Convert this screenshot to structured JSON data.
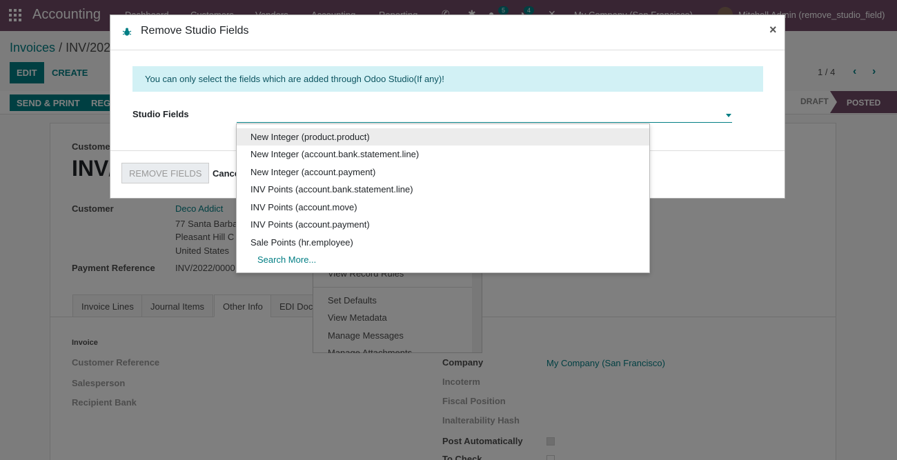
{
  "navbar": {
    "app_name": "Accounting",
    "menus": [
      "Dashboard",
      "Customers",
      "Vendors",
      "Accounting",
      "Reporting"
    ],
    "chat_count": "5",
    "activity_count": "4",
    "company": "My Company (San Francisco)",
    "user": "Mitchell Admin (remove_studio_field)"
  },
  "breadcrumb": {
    "parent": "Invoices",
    "current": "INV/2022"
  },
  "control": {
    "edit_label": "EDIT",
    "create_label": "CREATE",
    "pager": "1 / 4",
    "prev_icon": "‹",
    "next_icon": "›"
  },
  "statusbar": {
    "send_print_label": "SEND & PRINT",
    "register_label": "REGI",
    "stage_draft": "DRAFT",
    "stage_posted": "POSTED"
  },
  "sheet": {
    "type_label": "Customer",
    "title": "INV/",
    "customer_label": "Customer",
    "customer_name": "Deco Addict",
    "address_line1": "77 Santa Barba",
    "address_line2": "Pleasant Hill C",
    "address_line3": "United States",
    "payment_ref_label": "Payment Reference",
    "payment_ref_value": "INV/2022/0000",
    "tabs": [
      "Invoice Lines",
      "Journal Items",
      "Other Info",
      "EDI Docu"
    ],
    "section_invoice": "Invoice",
    "customer_reference_label": "Customer Reference",
    "salesperson_label": "Salesperson",
    "recipient_bank_label": "Recipient Bank",
    "company_label": "Company",
    "company_value": "My Company (San Francisco)",
    "incoterm_label": "Incoterm",
    "fiscal_position_label": "Fiscal Position",
    "inalterability_label": "Inalterability Hash",
    "post_auto_label": "Post Automatically",
    "to_check_label": "To Check"
  },
  "gear_menu": {
    "items": [
      "View Record Rules",
      "Set Defaults",
      "View Metadata",
      "Manage Messages",
      "Manage Attachments"
    ]
  },
  "modal": {
    "title": "Remove Studio Fields",
    "close_icon": "×",
    "alert": "You can only select the fields which are added through Odoo Studio(If any)!",
    "field_label": "Studio Fields",
    "remove_label": "REMOVE FIELDS",
    "cancel_label": "Cancel"
  },
  "autocomplete": {
    "options": [
      "New Integer (product.product)",
      "New Integer (account.bank.statement.line)",
      "New Integer (account.payment)",
      "INV Points (account.bank.statement.line)",
      "INV Points (account.move)",
      "INV Points (account.payment)",
      "Sale Points (hr.employee)"
    ],
    "search_more": "Search More..."
  },
  "colors": {
    "brand": "#714b67",
    "accent": "#017e84"
  }
}
